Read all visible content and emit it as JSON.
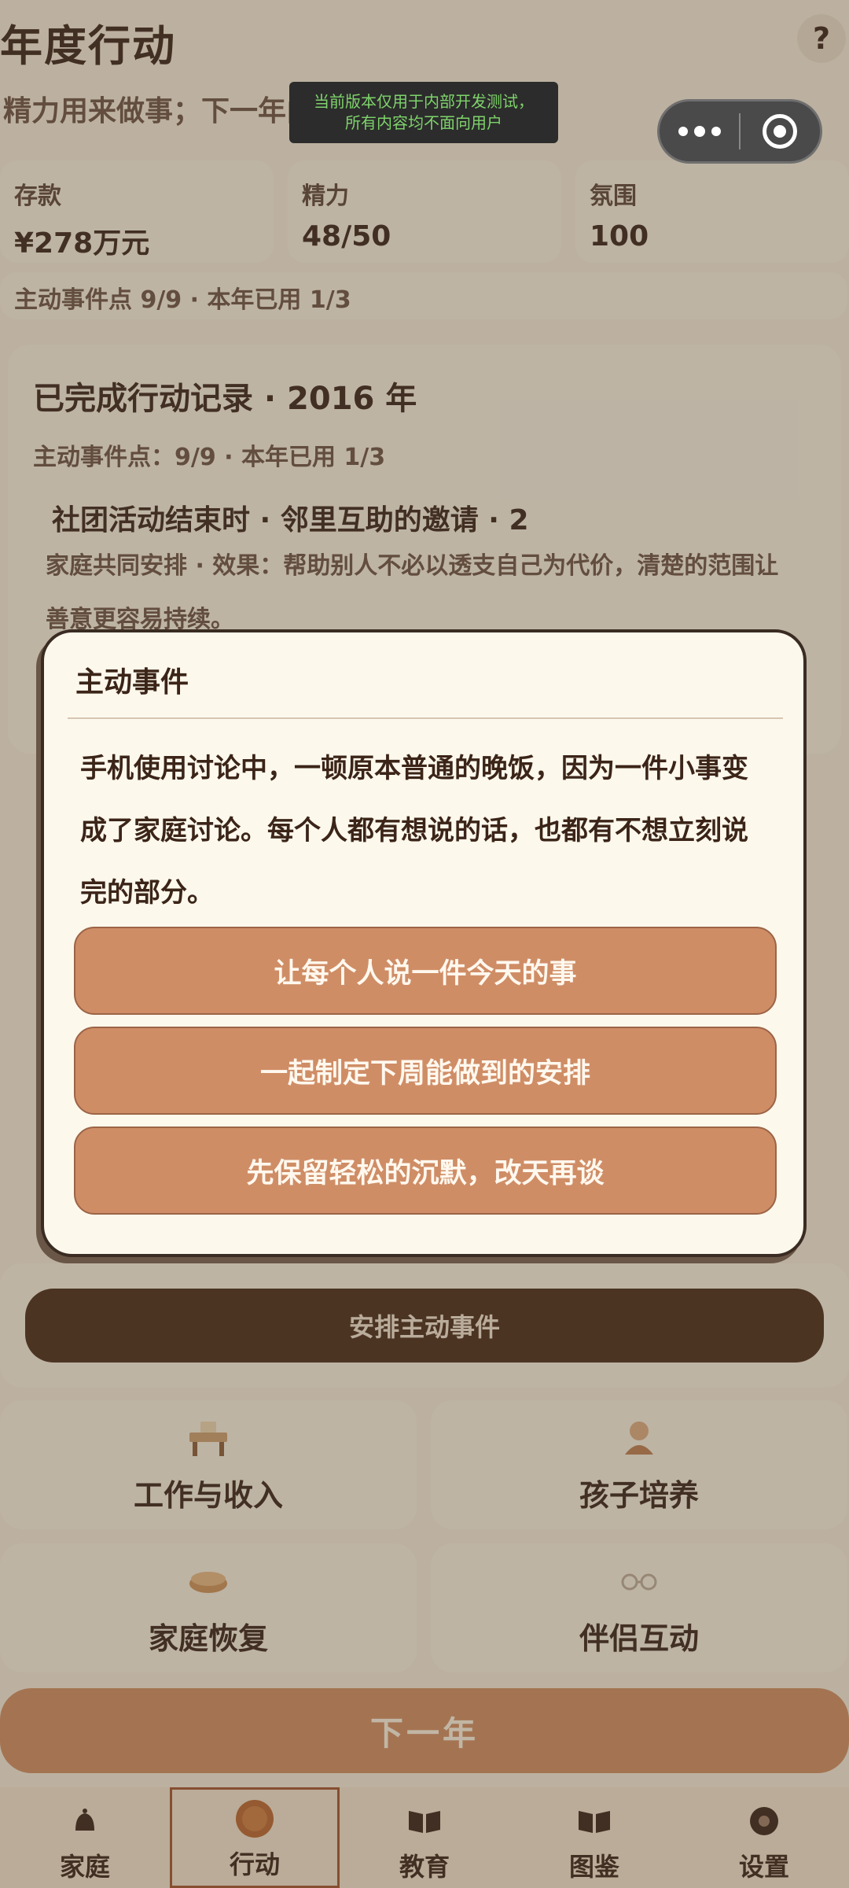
{
  "header": {
    "title": "年度行动",
    "subtitle": "精力用来做事；下一年由",
    "help_label": "?"
  },
  "dev_banner": {
    "line1": "当前版本仅用于内部开发测试，",
    "line2": "所有内容均不面向用户"
  },
  "stats": [
    {
      "label": "存款",
      "value": "¥278万元"
    },
    {
      "label": "精力",
      "value": "48/50"
    },
    {
      "label": "氛围",
      "value": "100"
    }
  ],
  "events_bar": "主动事件点 9/9 · 本年已用 1/3",
  "record": {
    "title": "已完成行动记录 · 2016 年",
    "subtitle": "主动事件点：9/9 · 本年已用 1/3",
    "item_title": "社团活动结束时 · 邻里互助的邀请 · 2",
    "item_desc": "家庭共同安排 · 效果：帮助别人不必以透支自己为代价，清楚的范围让善意更容易持续。"
  },
  "modal": {
    "title": "主动事件",
    "body": "手机使用讨论中，一顿原本普通的晚饭，因为一件小事变成了家庭讨论。每个人都有想说的话，也都有不想立刻说完的部分。",
    "options": [
      "让每个人说一件今天的事",
      "一起制定下周能做到的安排",
      "先保留轻松的沉默，改天再谈"
    ]
  },
  "arrange_button": "安排主动事件",
  "categories": [
    {
      "label": "工作与收入",
      "icon": "desk-icon"
    },
    {
      "label": "孩子培养",
      "icon": "child-icon"
    },
    {
      "label": "家庭恢复",
      "icon": "bread-icon"
    },
    {
      "label": "伴侣互动",
      "icon": "glasses-icon"
    }
  ],
  "next_year_button": "下一年",
  "tabs": [
    {
      "label": "家庭",
      "icon": "bell-icon"
    },
    {
      "label": "行动",
      "icon": "coin-icon",
      "active": true
    },
    {
      "label": "教育",
      "icon": "book-icon"
    },
    {
      "label": "图鉴",
      "icon": "open-book-icon"
    },
    {
      "label": "设置",
      "icon": "gear-icon"
    }
  ],
  "colors": {
    "background": "#efe3d0",
    "card": "#f1e7d6",
    "accent": "#cf8d66",
    "dark_button": "#4a2b18",
    "text": "#3b2418"
  }
}
